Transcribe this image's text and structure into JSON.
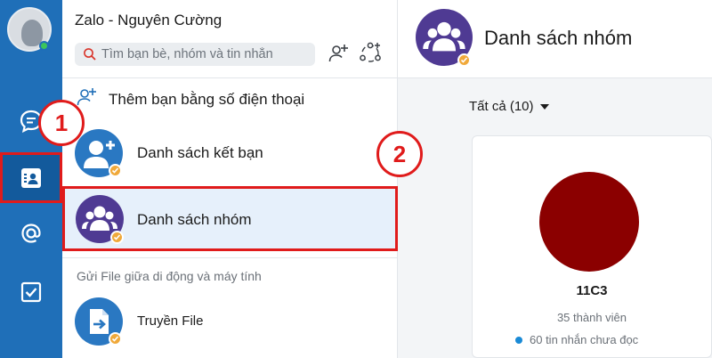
{
  "colors": {
    "accent_blue": "#1f6fb8",
    "annotation_red": "#e01b1b",
    "group_purple": "#4f3a93",
    "group_avatar_red": "#8b0000",
    "online_green": "#3cc55c"
  },
  "navbar": {
    "items": [
      {
        "name": "messages",
        "icon": "chat-icon"
      },
      {
        "name": "contacts",
        "icon": "contact-card-icon",
        "active": true
      },
      {
        "name": "mentions",
        "icon": "at-sign-icon"
      },
      {
        "name": "todo",
        "icon": "checkbox-icon"
      }
    ]
  },
  "panel": {
    "title": "Zalo - Nguyên Cường",
    "search_placeholder": "Tìm bạn bè, nhóm và tin nhắn",
    "add_by_phone": "Thêm bạn bằng số điện thoại",
    "friends_list": "Danh sách kết bạn",
    "group_list": "Danh sách nhóm",
    "section_file": "Gửi File giữa di động và máy tính",
    "file_transfer": "Truyền File"
  },
  "content": {
    "title": "Danh sách nhóm",
    "filter": "Tất cả (10)",
    "group": {
      "name": "11C3",
      "members": "35 thành viên",
      "unread": "60 tin nhắn chưa đọc"
    }
  },
  "steps": {
    "step1": "1",
    "step2": "2"
  }
}
